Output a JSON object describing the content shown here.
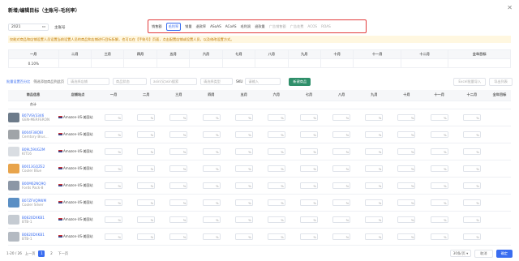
{
  "dialog": {
    "title": "新增/编辑目标（主账号-毛利率）",
    "close_icon": "close-icon"
  },
  "filters": {
    "year": "2021",
    "account": "主账号"
  },
  "metric_tabs": [
    {
      "label": "销售额",
      "state": "normal"
    },
    {
      "label": "毛利率",
      "state": "active"
    },
    {
      "label": "销量",
      "state": "normal"
    },
    {
      "label": "退款率",
      "state": "normal"
    },
    {
      "label": "ASoAS",
      "state": "normal"
    },
    {
      "label": "ACoAS",
      "state": "normal"
    },
    {
      "label": "毛利润",
      "state": "normal"
    },
    {
      "label": "退款量",
      "state": "normal"
    },
    {
      "label": "广告销售额",
      "state": "disabled"
    },
    {
      "label": "广告花费",
      "state": "disabled"
    },
    {
      "label": "ACOS",
      "state": "disabled"
    },
    {
      "label": "ROAS",
      "state": "disabled"
    }
  ],
  "notice": "仅能对商品和店铺设置人员设置当前设置人员的商品和店铺进行目标拆解，也可以在【手账号】页面，点击配置店铺或设置人员，以及修改设置方式。",
  "summary": {
    "months": [
      "一月",
      "二月",
      "三月",
      "四月",
      "五月",
      "六月",
      "七月",
      "八月",
      "九月",
      "十月",
      "十一月",
      "十二月",
      "全年目标"
    ],
    "values": [
      "0.10%",
      "",
      "",
      "",
      "",
      "",
      "",
      "",
      "",
      "",
      "",
      "",
      ""
    ]
  },
  "toolbar": {
    "batch_link": "批量设置百分比",
    "filter_link": "筛选添加商品到此页",
    "store_placeholder": "请选择店铺",
    "status_placeholder": "商品状态",
    "asin_placeholder": "asin/父asin搜索",
    "type_placeholder": "请选择类型",
    "sku_label": "SKU",
    "sku_placeholder": "请输入",
    "add_button": "新建商品",
    "import_button": "Excel批量导入",
    "export_button": "导出列表"
  },
  "grid": {
    "headers": [
      "商品信息",
      "店铺站点",
      "一月",
      "二月",
      "三月",
      "四月",
      "五月",
      "六月",
      "七月",
      "八月",
      "九月",
      "十月",
      "十一月",
      "十二月",
      "全年目标"
    ],
    "total_label": "合计",
    "input_suffix": "%",
    "rows": [
      {
        "asin": "B07VSV3346",
        "pn": "GEN-MERFERON",
        "store": "Amazon-US-美国站",
        "thumb": "#6d7b8a"
      },
      {
        "asin": "B004F38OBI",
        "pn": "Cemtory Brus...",
        "store": "Amazon-US-美国站",
        "thumb": "#a0a4a8"
      },
      {
        "asin": "B09L59UG2M",
        "pn": "KIT16",
        "store": "Amazon-US-美国站",
        "thumb": "#d9dde2"
      },
      {
        "asin": "B0013GQZE2",
        "pn": "Cooler Blue",
        "store": "Amazon-US-美国站",
        "thumb": "#e8a44c"
      },
      {
        "asin": "B00M62NQ9Q",
        "pn": "Fords Pack-8",
        "store": "Amazon-US-美国站",
        "thumb": "#8c97a6"
      },
      {
        "asin": "B07ZFVQ9WM",
        "pn": "Cooler Silver",
        "store": "Amazon-US-美国站",
        "thumb": "#5b8fc4"
      },
      {
        "asin": "B0820DXKB1",
        "pn": "BTB-1",
        "store": "Amazon-US-美国站",
        "thumb": "#c5cbd2"
      },
      {
        "asin": "B0820DXKB1",
        "pn": "BTB-1",
        "store": "Amazon-US-美国站",
        "thumb": "#b4bac2"
      }
    ]
  },
  "pager": {
    "range": "1-20 / 26",
    "prev": "上一页",
    "pages": [
      "1",
      "2"
    ],
    "next": "下一页",
    "page_size": "30条/页",
    "cancel": "取消",
    "ok": "确定"
  },
  "colors": {
    "accent": "#3a6df0",
    "highlight_border": "#e23b3b",
    "primary_green": "#2f8f6a"
  }
}
